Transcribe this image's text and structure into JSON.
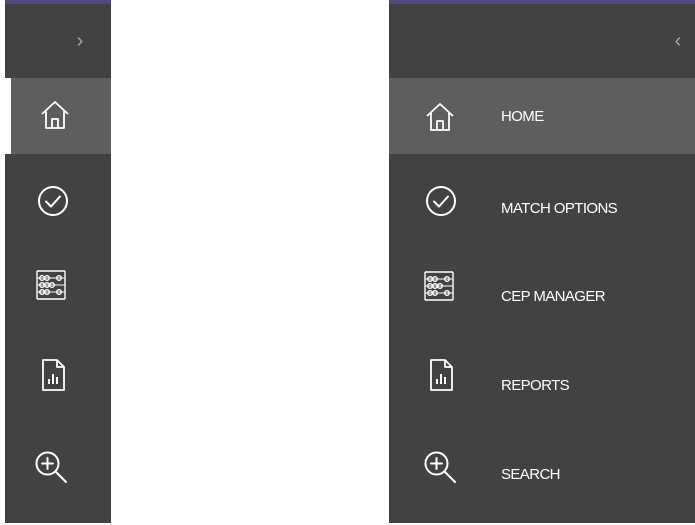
{
  "collapsed_sidebar": {
    "toggle_glyph": "›",
    "items": [
      {
        "icon": "home-icon"
      },
      {
        "icon": "check-circle-icon"
      },
      {
        "icon": "abacus-icon"
      },
      {
        "icon": "report-icon"
      },
      {
        "icon": "zoom-in-icon"
      }
    ]
  },
  "expanded_sidebar": {
    "toggle_glyph": "‹",
    "items": [
      {
        "icon": "home-icon",
        "label": "HOME"
      },
      {
        "icon": "check-circle-icon",
        "label": "MATCH OPTIONS"
      },
      {
        "icon": "abacus-icon",
        "label": "CEP MANAGER"
      },
      {
        "icon": "report-icon",
        "label": "REPORTS"
      },
      {
        "icon": "zoom-in-icon",
        "label": "SEARCH"
      }
    ]
  },
  "colors": {
    "sidebar_bg": "#424242",
    "active_bg": "#5e5e5e",
    "accent_top": "#4d4a82",
    "text": "#ffffff"
  }
}
